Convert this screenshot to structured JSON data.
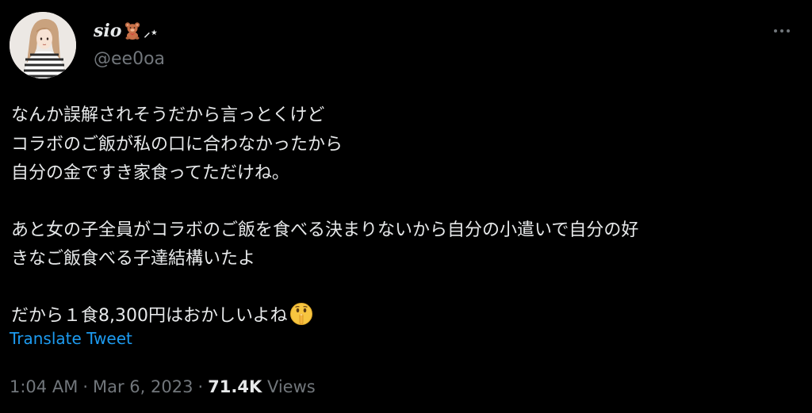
{
  "author": {
    "display_name": "sio",
    "name_emoji": "teddy-bear-emoji",
    "name_sparkle": "⸝⋆",
    "handle": "@ee0oa"
  },
  "tweet": {
    "lines": [
      "なんか誤解されそうだから言っとくけど",
      "コラボのご飯が私の口に合わなかったから",
      "自分の金ですき家食ってただけね。",
      "あと女の子全員がコラボのご飯を食べる決まりないから自分の小遣いで自分の好",
      "きなご飯食べる子達結構いたよ",
      "だから１食8,300円はおかしいよね"
    ],
    "end_emoji": "shushing-face-emoji"
  },
  "translate_label": "Translate Tweet",
  "meta": {
    "time": "1:04 AM",
    "separator": "·",
    "date": "Mar 6, 2023",
    "views_count": "71.4K",
    "views_label": "Views"
  },
  "colors": {
    "background": "#000000",
    "text_primary": "#e7e9ea",
    "text_secondary": "#71767b",
    "link": "#1d9bf0"
  }
}
